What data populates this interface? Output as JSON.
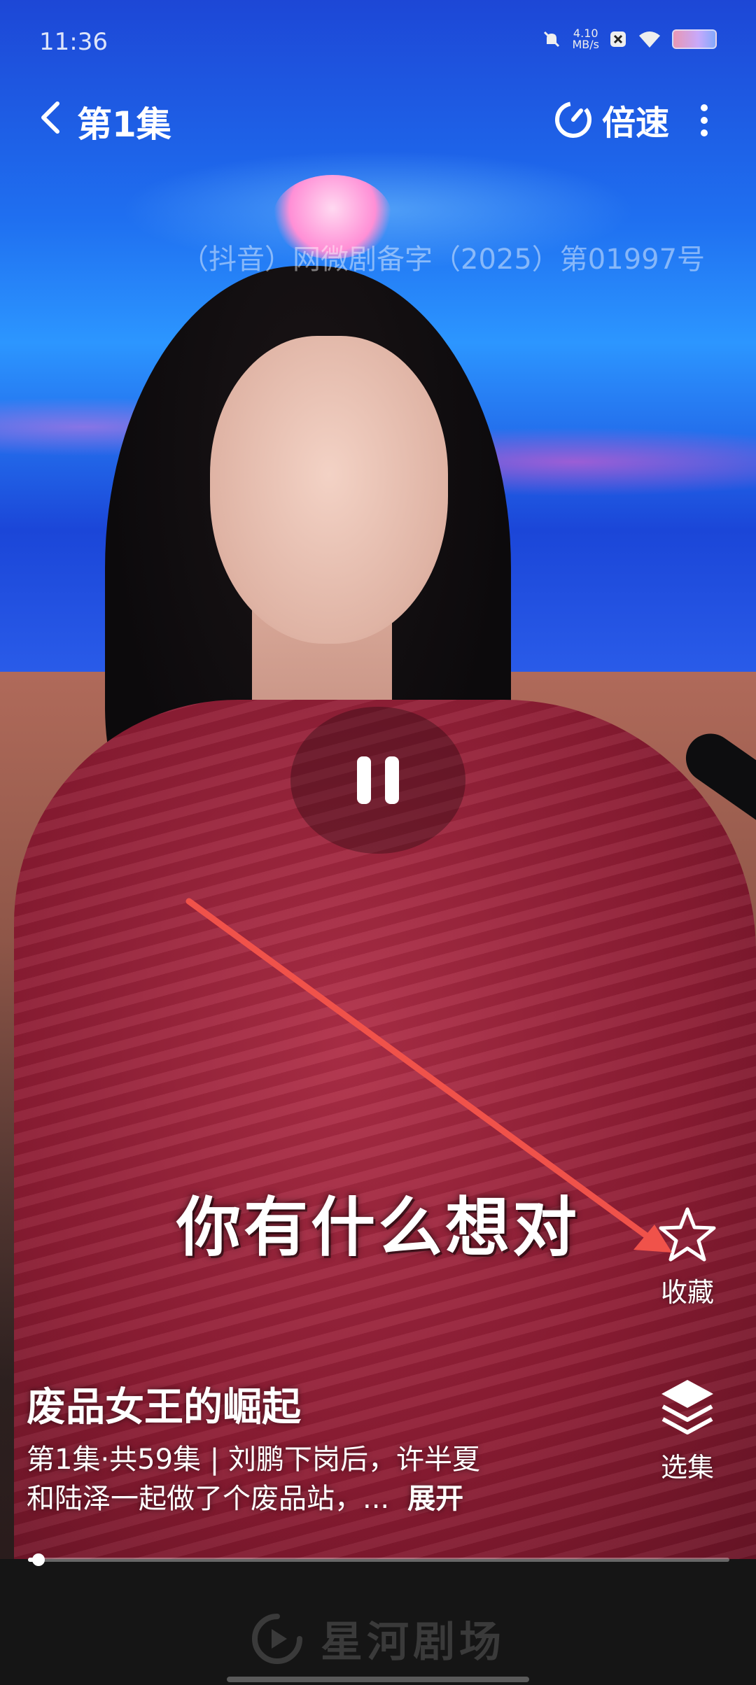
{
  "status_bar": {
    "time": "11:36",
    "network_speed_value": "4.10",
    "network_speed_unit": "MB/s"
  },
  "header": {
    "episode_title": "第1集",
    "speed_label": "倍速"
  },
  "video": {
    "license_watermark": "（抖音）网微剧备字（2025）第01997号",
    "subtitle": "你有什么想对",
    "state": "playing"
  },
  "side_actions": {
    "favorite_label": "收藏",
    "episodes_label": "选集"
  },
  "drama": {
    "title": "废品女王的崛起",
    "desc_line1": "第1集·共59集 | 刘鹏下岗后，许半夏",
    "desc_line2": "和陆泽一起做了个废品站，...",
    "expand_label": "展开"
  },
  "progress": {
    "fraction": 0.015
  },
  "footer": {
    "brand_name": "星河剧场"
  },
  "colors": {
    "annotation_arrow": "#f0524a",
    "brand_text": "#3a3a3a"
  },
  "icons": [
    "back-arrow-icon",
    "speed-gauge-icon",
    "more-vertical-icon",
    "pause-icon",
    "star-icon",
    "layers-icon",
    "play-logo-icon",
    "mute-bell-icon",
    "wifi-icon",
    "battery-icon"
  ]
}
